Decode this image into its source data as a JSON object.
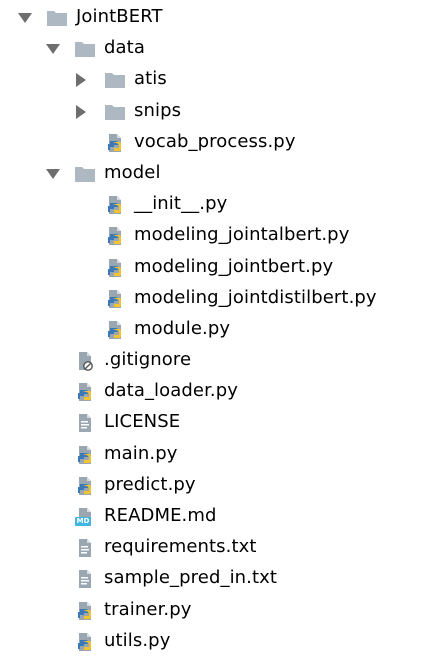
{
  "tree": [
    {
      "label": "JointBERT",
      "type": "folder",
      "depth": 0,
      "expanded": true
    },
    {
      "label": "data",
      "type": "folder",
      "depth": 1,
      "expanded": true
    },
    {
      "label": "atis",
      "type": "folder",
      "depth": 2,
      "expanded": false
    },
    {
      "label": "snips",
      "type": "folder",
      "depth": 2,
      "expanded": false
    },
    {
      "label": "vocab_process.py",
      "type": "python",
      "depth": 2
    },
    {
      "label": "model",
      "type": "folder",
      "depth": 1,
      "expanded": true
    },
    {
      "label": "__init__.py",
      "type": "python",
      "depth": 2
    },
    {
      "label": "modeling_jointalbert.py",
      "type": "python",
      "depth": 2
    },
    {
      "label": "modeling_jointbert.py",
      "type": "python",
      "depth": 2
    },
    {
      "label": "modeling_jointdistilbert.py",
      "type": "python",
      "depth": 2
    },
    {
      "label": "module.py",
      "type": "python",
      "depth": 2
    },
    {
      "label": ".gitignore",
      "type": "ignore",
      "depth": 1
    },
    {
      "label": "data_loader.py",
      "type": "python",
      "depth": 1
    },
    {
      "label": "LICENSE",
      "type": "text",
      "depth": 1
    },
    {
      "label": "main.py",
      "type": "python",
      "depth": 1
    },
    {
      "label": "predict.py",
      "type": "python",
      "depth": 1
    },
    {
      "label": "README.md",
      "type": "markdown",
      "depth": 1
    },
    {
      "label": "requirements.txt",
      "type": "text",
      "depth": 1
    },
    {
      "label": "sample_pred_in.txt",
      "type": "text",
      "depth": 1
    },
    {
      "label": "trainer.py",
      "type": "python",
      "depth": 1
    },
    {
      "label": "utils.py",
      "type": "python",
      "depth": 1
    }
  ],
  "icons": {
    "folder": "folder-icon",
    "python": "python-file-icon",
    "text": "text-file-icon",
    "ignore": "gitignore-file-icon",
    "markdown": "markdown-file-icon"
  },
  "icon_text": {
    "markdown": "MD"
  },
  "colors": {
    "folder": "#aeb8c2",
    "file_page": "#9aa7b0",
    "python_blue": "#3b78b7",
    "python_yellow": "#f4c430",
    "arrow": "#6e6e6e",
    "markdown_badge": "#40b6e0"
  }
}
